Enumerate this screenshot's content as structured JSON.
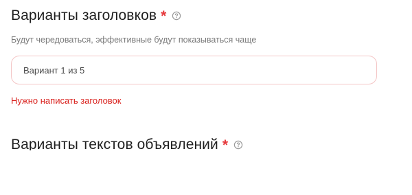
{
  "headlines": {
    "title": "Варианты заголовков",
    "required_mark": "*",
    "help_icon": "question-circle-icon",
    "description": "Будут чередоваться, эффективные будут показываться чаще",
    "input_value": "Вариант 1 из 5",
    "error_text": "Нужно написать заголовок"
  },
  "ad_texts": {
    "title": "Варианты текстов объявлений",
    "required_mark": "*",
    "help_icon": "question-circle-icon"
  },
  "colors": {
    "required": "#e6383b",
    "error": "#d9201c",
    "input_border_error": "#f4c6c6",
    "heading": "#1f1f1f",
    "muted": "#7a7a7a"
  }
}
